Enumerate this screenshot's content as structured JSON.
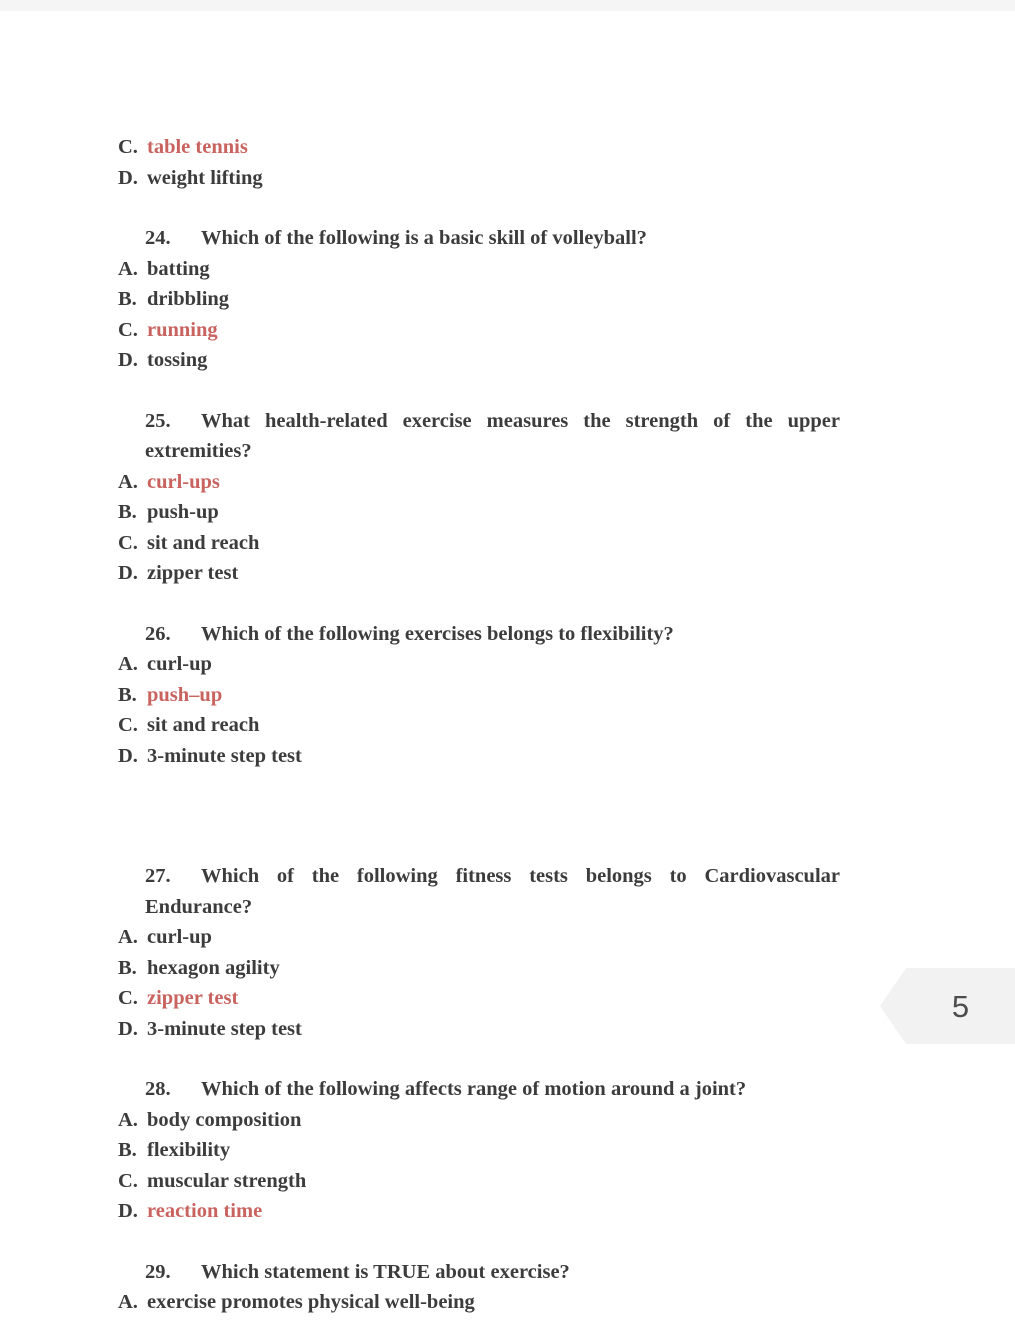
{
  "document": {
    "page_badge": {
      "number": "5"
    },
    "continued_options": [
      {
        "label": "C.",
        "text": "table tennis",
        "highlighted": true
      },
      {
        "label": "D.",
        "text": "weight lifting",
        "highlighted": false
      }
    ],
    "questions": [
      {
        "number": "24.",
        "text": "Which of the following is a basic skill of volleyball?",
        "justified": false,
        "gap": "normal",
        "options": [
          {
            "label": "A.",
            "text": "batting",
            "highlighted": false
          },
          {
            "label": "B.",
            "text": "dribbling",
            "highlighted": false
          },
          {
            "label": "C.",
            "text": "running",
            "highlighted": true
          },
          {
            "label": "D.",
            "text": "tossing",
            "highlighted": false
          }
        ]
      },
      {
        "number": "25.",
        "text": "What health-related exercise measures the strength of the upper extremities?",
        "justified": true,
        "gap": "normal",
        "options": [
          {
            "label": "A.",
            "text": "curl-ups",
            "highlighted": true
          },
          {
            "label": "B.",
            "text": "push-up",
            "highlighted": false
          },
          {
            "label": "C.",
            "text": "sit and reach",
            "highlighted": false
          },
          {
            "label": "D.",
            "text": "zipper test",
            "highlighted": false
          }
        ]
      },
      {
        "number": "26.",
        "text": "Which of the following exercises belongs to flexibility?",
        "justified": false,
        "gap": "normal",
        "options": [
          {
            "label": "A.",
            "text": "curl-up",
            "highlighted": false
          },
          {
            "label": "B.",
            "text": "push–up",
            "highlighted": true
          },
          {
            "label": "C.",
            "text": "sit and reach",
            "highlighted": false
          },
          {
            "label": "D.",
            "text": "3-minute step test",
            "highlighted": false
          }
        ]
      },
      {
        "number": "27.",
        "text": "Which of the following fitness tests belongs to Cardiovascular Endurance?",
        "justified": true,
        "gap": "large",
        "options": [
          {
            "label": "A.",
            "text": "curl-up",
            "highlighted": false
          },
          {
            "label": "B.",
            "text": "hexagon agility",
            "highlighted": false
          },
          {
            "label": "C.",
            "text": "zipper test",
            "highlighted": true
          },
          {
            "label": "D.",
            "text": "3-minute step test",
            "highlighted": false
          }
        ]
      },
      {
        "number": "28.",
        "text": "Which of the following affects range of motion around a joint?",
        "justified": false,
        "gap": "normal",
        "options": [
          {
            "label": "A.",
            "text": "body composition",
            "highlighted": false
          },
          {
            "label": "B.",
            "text": "flexibility",
            "highlighted": false
          },
          {
            "label": "C.",
            "text": "muscular strength",
            "highlighted": false
          },
          {
            "label": "D.",
            "text": "reaction time",
            "highlighted": true
          }
        ]
      },
      {
        "number": "29.",
        "text": "Which statement is TRUE about exercise?",
        "justified": false,
        "gap": "normal",
        "options": [
          {
            "label": "A.",
            "text": "exercise promotes physical well-being",
            "highlighted": false
          }
        ]
      }
    ],
    "colors": {
      "text": "#3c3c3c",
      "highlight": "#c9635f",
      "badge_background": "#f2f2f2",
      "top_strip": "#f5f5f5"
    }
  }
}
